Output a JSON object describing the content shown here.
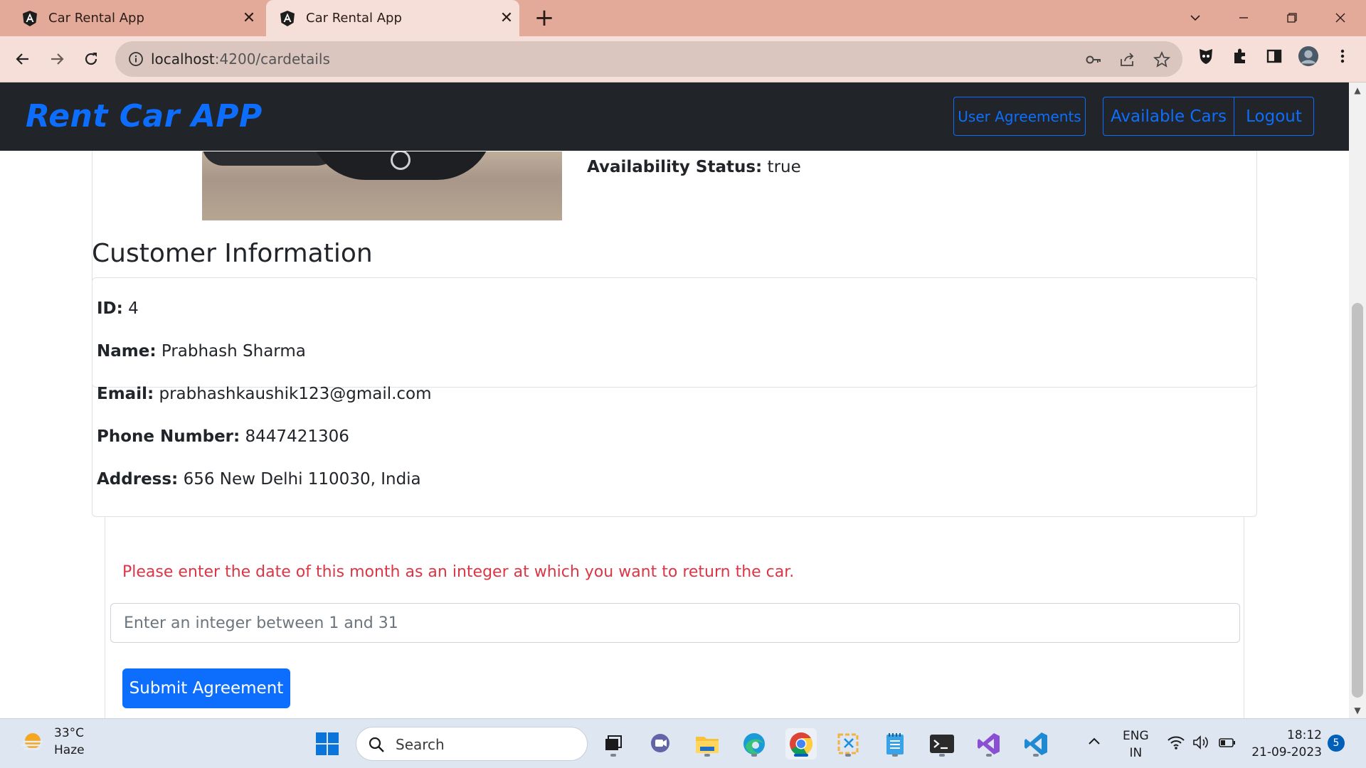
{
  "browser": {
    "tabs": [
      {
        "title": "Car Rental App",
        "favicon": "angular-icon"
      },
      {
        "title": "Car Rental App",
        "favicon": "angular-icon"
      }
    ],
    "url_host": "localhost",
    "url_path": ":4200/cardetails"
  },
  "app": {
    "brand": "Rent Car APP",
    "nav": {
      "user_agreements": "User Agreements",
      "available_cars": "Available Cars",
      "logout": "Logout"
    },
    "car": {
      "availability_label": "Availability Status:",
      "availability_value": "true"
    },
    "customer": {
      "section_title": "Customer Information",
      "fields": [
        {
          "label": "ID:",
          "value": "4"
        },
        {
          "label": "Name:",
          "value": "Prabhash Sharma"
        },
        {
          "label": "Email:",
          "value": "prabhashkaushik123@gmail.com"
        },
        {
          "label": "Phone Number:",
          "value": "8447421306"
        },
        {
          "label": "Address:",
          "value": "656 New Delhi 110030, India"
        }
      ]
    },
    "form": {
      "instruction": "Please enter the date of this month as an integer at which you want to return the car.",
      "input_placeholder": "Enter an integer between 1 and 31",
      "input_value": "",
      "submit_label": "Submit Agreement"
    }
  },
  "colors": {
    "primary": "#0d6efd",
    "danger": "#dc3545",
    "navbar_bg": "#212529",
    "tabbar_bg": "#e3aa9a"
  },
  "taskbar": {
    "weather_temp": "33°C",
    "weather_desc": "Haze",
    "search_label": "Search",
    "lang_line1": "ENG",
    "lang_line2": "IN",
    "time": "18:12",
    "date": "21-09-2023",
    "notification_count": "5"
  }
}
